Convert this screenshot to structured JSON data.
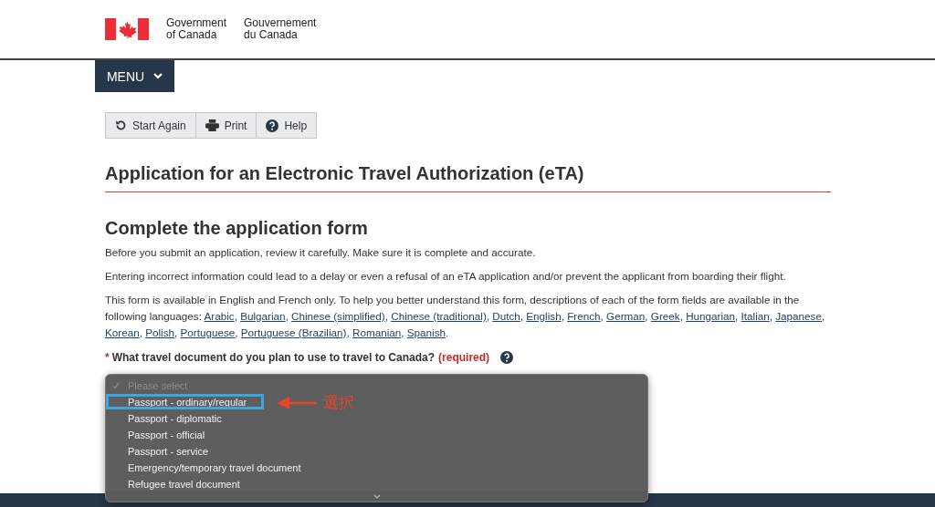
{
  "header": {
    "name_en": [
      "Government",
      "of Canada"
    ],
    "name_fr": [
      "Gouvernement",
      "du Canada"
    ]
  },
  "menu": {
    "label": "MENU"
  },
  "toolbar": [
    {
      "kind": "restart",
      "label": "Start Again"
    },
    {
      "kind": "print",
      "label": "Print"
    },
    {
      "kind": "help",
      "label": "Help"
    }
  ],
  "title": "Application for an Electronic Travel Authorization (eTA)",
  "section_heading": "Complete the application form",
  "paragraphs": [
    "Before you submit an application, review it carefully. Make sure it is complete and accurate.",
    "Entering incorrect information could lead to a delay or even a refusal of an eTA application and/or prevent the applicant from boarding their flight."
  ],
  "languages_intro": "This form is available in English and French only. To help you better understand this form, descriptions of each of the form fields are available in the following languages:",
  "languages": [
    {
      "label": "Arabic",
      "after": ","
    },
    {
      "label": "Bulgarian",
      "after": ","
    },
    {
      "label": "Chinese (simplified)",
      "after": ","
    },
    {
      "label": "Chinese (traditional)",
      "after": ","
    },
    {
      "label": "Dutch",
      "after": ","
    },
    {
      "label": "English",
      "after": ","
    },
    {
      "label": "French",
      "after": ","
    },
    {
      "label": "German",
      "after": ","
    },
    {
      "label": "Greek",
      "after": ","
    },
    {
      "label": "Hungarian",
      "after": ","
    },
    {
      "label": "Italian",
      "after": ","
    },
    {
      "label": "Japanese",
      "after": ","
    },
    {
      "label": "Korean",
      "after": ","
    },
    {
      "label": "Polish",
      "after": ","
    },
    {
      "label": "Portuguese",
      "after": ","
    },
    {
      "label": "Portuguese (Brazilian)",
      "after": ","
    },
    {
      "label": "Romanian",
      "after": ","
    },
    {
      "label": "Spanish",
      "after": "."
    }
  ],
  "question": {
    "asterisk": "*",
    "label": "What travel document do you plan to use to travel to Canada?",
    "required": "(required)"
  },
  "dropdown": {
    "options": [
      {
        "label": "Please select",
        "checked": true,
        "disabled": true,
        "highlighted": false
      },
      {
        "label": "Passport - ordinary/regular",
        "checked": false,
        "disabled": false,
        "highlighted": true
      },
      {
        "label": "Passport - diplomatic",
        "checked": false,
        "disabled": false,
        "highlighted": false
      },
      {
        "label": "Passport - official",
        "checked": false,
        "disabled": false,
        "highlighted": false
      },
      {
        "label": "Passport - service",
        "checked": false,
        "disabled": false,
        "highlighted": false
      },
      {
        "label": "Emergency/temporary travel document",
        "checked": false,
        "disabled": false,
        "highlighted": false
      },
      {
        "label": "Refugee travel document",
        "checked": false,
        "disabled": false,
        "highlighted": false
      }
    ]
  },
  "annotation": {
    "label": "選択"
  }
}
